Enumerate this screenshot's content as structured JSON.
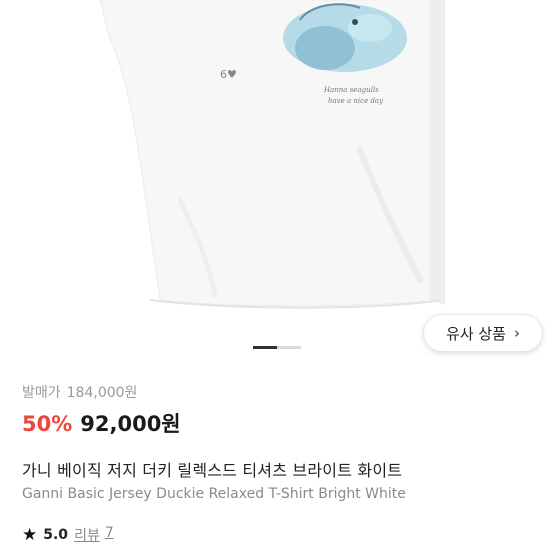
{
  "product": {
    "image_alt": "Ganni duckie t-shirt",
    "print_text": [
      "Hanna seagulls",
      "have a nice day"
    ],
    "logo": "6♥"
  },
  "similar_button": {
    "label": "유사 상품",
    "icon": "chevron-right-icon"
  },
  "carousel": {
    "count": 2,
    "active": 0
  },
  "pricing": {
    "original_label": "발매가",
    "original_price": "184,000원",
    "discount": "50%",
    "sale_price": "92,000원",
    "discount_color": "#f0453a"
  },
  "title": {
    "korean": "가니 베이직 저지 더키 릴렉스드 티셔츠 브라이트 화이트",
    "english": "Ganni Basic Jersey Duckie Relaxed T-Shirt Bright White"
  },
  "rating": {
    "score": "5.0",
    "review_label": "리뷰",
    "review_count": "7",
    "icon": "star-icon"
  }
}
